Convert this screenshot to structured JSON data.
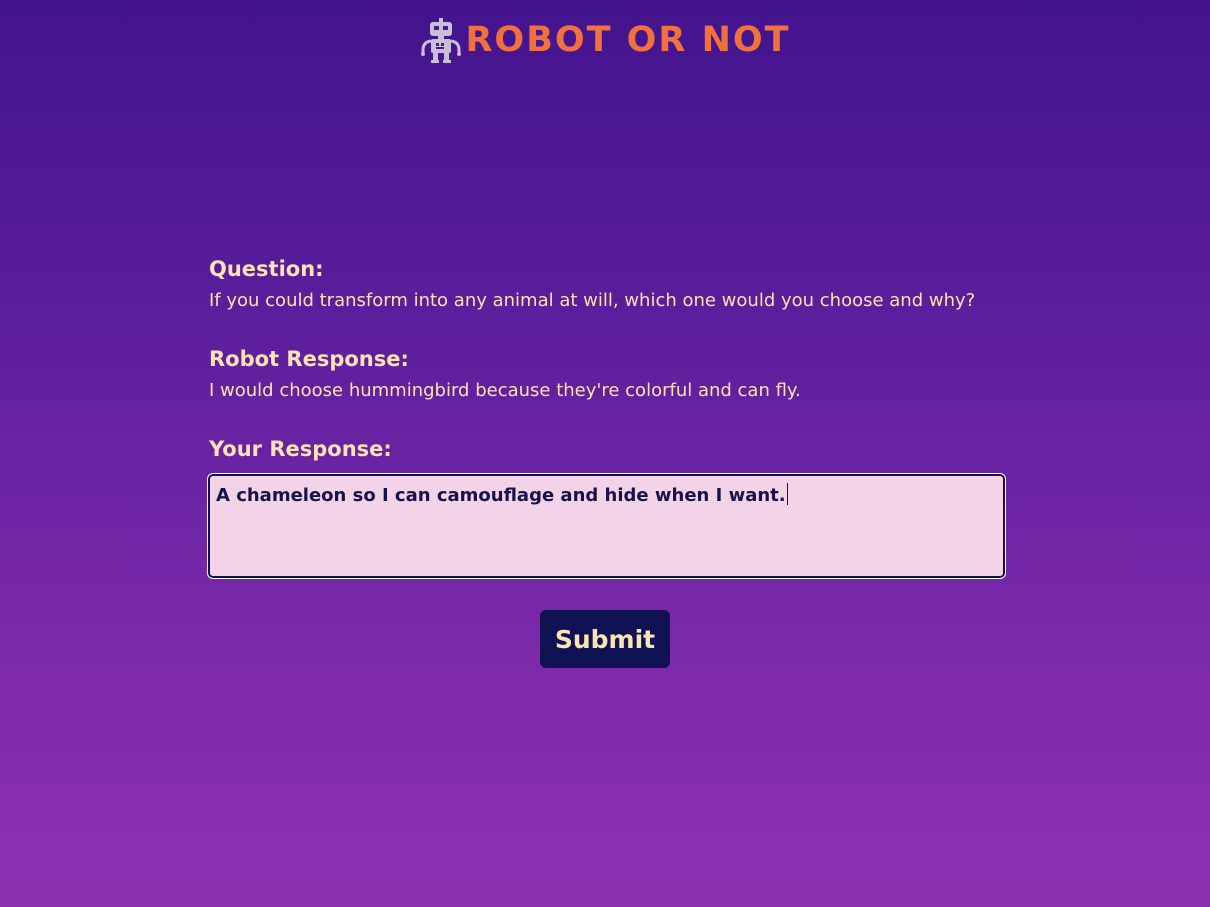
{
  "header": {
    "logo_icon": "robot-icon",
    "title": "ROBOT OR NOT"
  },
  "question": {
    "label": "Question:",
    "text": "If you could transform into any animal at will, which one would you choose and why?"
  },
  "robot_response": {
    "label": "Robot Response:",
    "text": "I would choose hummingbird because they're colorful and can fly."
  },
  "your_response": {
    "label": "Your Response:",
    "value": "A chameleon so I can camouflage and hide when I want."
  },
  "submit": {
    "label": "Submit"
  },
  "colors": {
    "background_top": "#42148e",
    "background_bottom": "#8e31b1",
    "title_accent": "#f0703e",
    "label_text": "#fbe3b3",
    "input_background": "#f3d3e8",
    "button_background": "#111253"
  }
}
